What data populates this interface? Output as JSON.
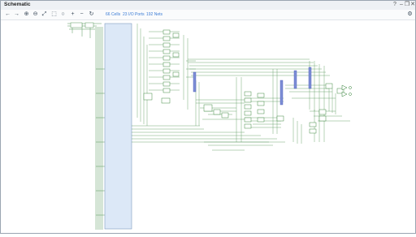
{
  "window": {
    "title": "Schematic"
  },
  "window_controls": [
    {
      "name": "help-icon",
      "glyph": "?"
    },
    {
      "name": "minimize-icon",
      "glyph": "–"
    },
    {
      "name": "restore-icon",
      "glyph": "❐"
    },
    {
      "name": "close-icon",
      "glyph": "✕"
    }
  ],
  "toolbar": {
    "buttons": [
      {
        "name": "back-arrow-icon",
        "glyph": "←"
      },
      {
        "name": "forward-arrow-icon",
        "glyph": "→"
      },
      {
        "name": "zoom-in-icon",
        "glyph": "⊕"
      },
      {
        "name": "zoom-out-icon",
        "glyph": "⊖"
      },
      {
        "name": "zoom-fit-icon",
        "glyph": "⤢"
      },
      {
        "name": "zoom-area-icon",
        "glyph": "⬚"
      },
      {
        "name": "settings-circle-icon",
        "glyph": "○"
      },
      {
        "name": "add-icon",
        "glyph": "+"
      },
      {
        "name": "remove-icon",
        "glyph": "−"
      },
      {
        "name": "refresh-icon",
        "glyph": "↻"
      }
    ],
    "stats": [
      "66 Cells",
      "23 I/O Ports",
      "192 Nets"
    ],
    "gear": {
      "name": "gear-icon",
      "glyph": "⚙"
    }
  }
}
